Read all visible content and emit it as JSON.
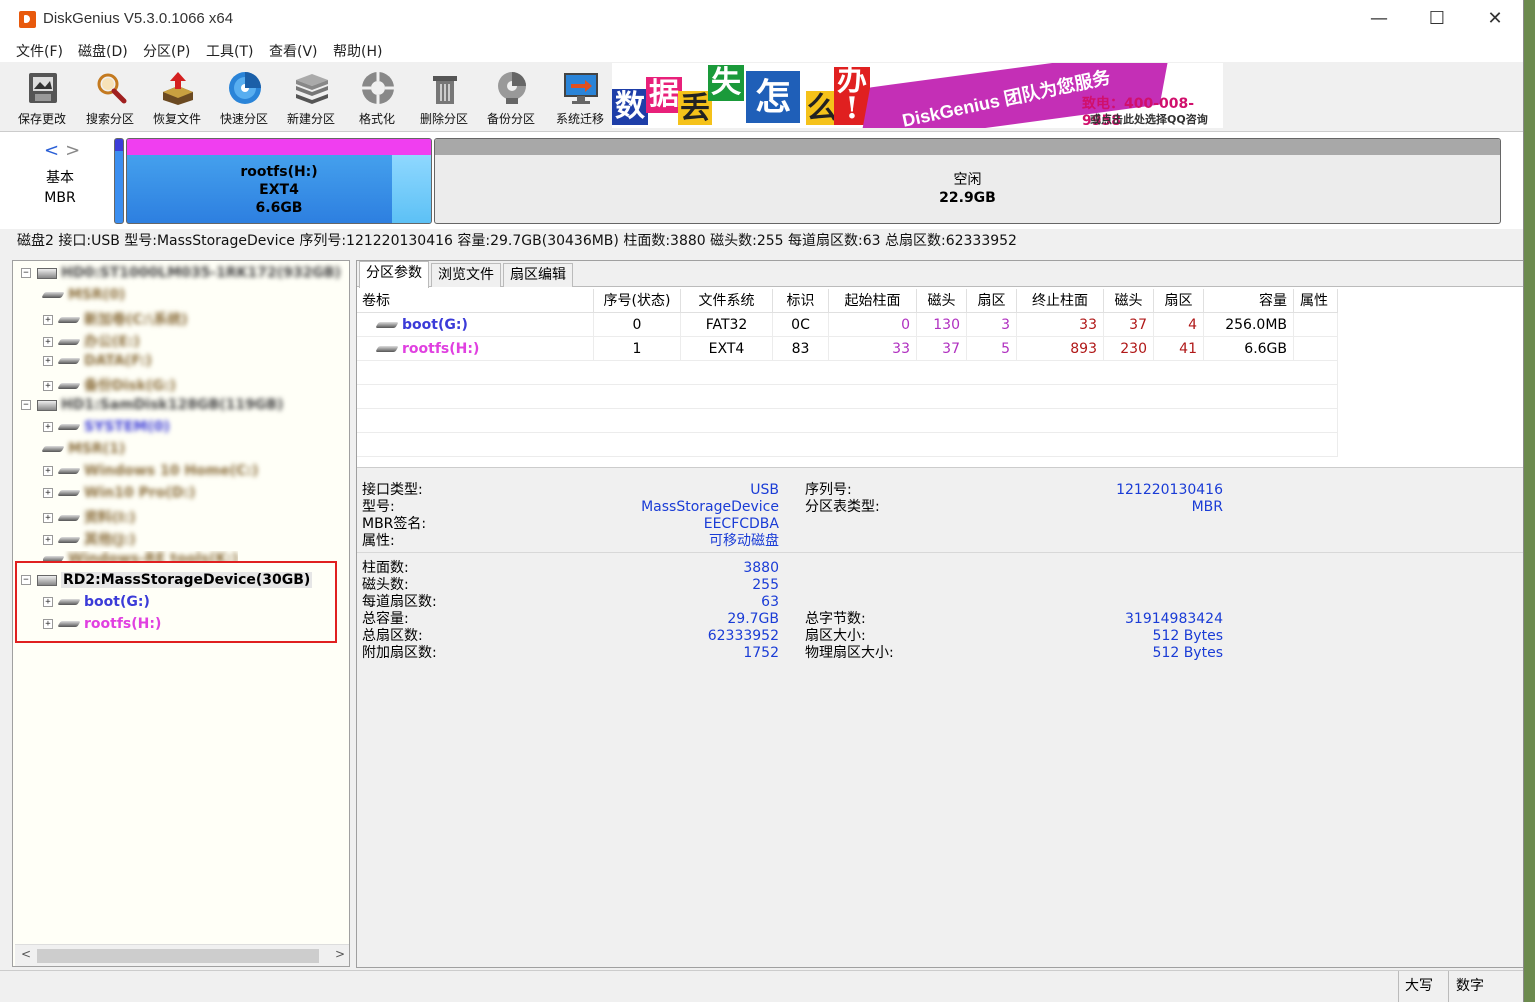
{
  "window": {
    "title": "DiskGenius V5.3.0.1066 x64"
  },
  "controls": {
    "minimize": "—",
    "maximize": "☐",
    "close": "✕"
  },
  "menu": [
    "文件(F)",
    "磁盘(D)",
    "分区(P)",
    "工具(T)",
    "查看(V)",
    "帮助(H)"
  ],
  "toolbar": [
    {
      "label": "保存更改",
      "icon": "save-icon"
    },
    {
      "label": "搜索分区",
      "icon": "search-icon"
    },
    {
      "label": "恢复文件",
      "icon": "recover-icon"
    },
    {
      "label": "快速分区",
      "icon": "quick-partition-icon"
    },
    {
      "label": "新建分区",
      "icon": "new-partition-icon"
    },
    {
      "label": "格式化",
      "icon": "format-icon"
    },
    {
      "label": "删除分区",
      "icon": "delete-icon"
    },
    {
      "label": "备份分区",
      "icon": "backup-icon"
    },
    {
      "label": "系统迁移",
      "icon": "migrate-icon"
    }
  ],
  "banner": {
    "chars": [
      "数",
      "据",
      "丢",
      "失",
      "怎",
      "么",
      "办",
      "!"
    ],
    "slogan": "DiskGenius 团队为您服务",
    "phone": "致电：400-008-9958",
    "qq": "或点击此处选择QQ咨询"
  },
  "diskmap": {
    "type_line1": "基本",
    "type_line2": "MBR",
    "partition1": {
      "name": "rootfs(H:)",
      "fs": "EXT4",
      "size": "6.6GB"
    },
    "free": {
      "name": "空闲",
      "size": "22.9GB"
    }
  },
  "disk_info_line": "磁盘2 接口:USB  型号:MassStorageDevice  序列号:121220130416  容量:29.7GB(30436MB)  柱面数:3880  磁头数:255  每道扇区数:63  总扇区数:62333952",
  "tree": {
    "disk0": "HD0:ST1000LM035-1RK172(932GB)",
    "disk0_parts": [
      "MSR(0)",
      "新加卷(C:\\系统)",
      "办公(E:)",
      "DATA(F:)",
      "备份Disk(G:)"
    ],
    "disk1": "HD1:SamDisk128GB(119GB)",
    "disk1_parts": [
      "SYSTEM(0)",
      "MSR(1)",
      "Windows 10 Home(C:)",
      "Win10 Pro(D:)",
      "资料(I:)",
      "其他(J:)",
      "Windows-RE tools(K:)"
    ],
    "disk2": "RD2:MassStorageDevice(30GB)",
    "disk2_parts": [
      "boot(G:)",
      "rootfs(H:)"
    ]
  },
  "tabs": [
    "分区参数",
    "浏览文件",
    "扇区编辑"
  ],
  "table": {
    "headers": [
      "卷标",
      "序号(状态)",
      "文件系统",
      "标识",
      "起始柱面",
      "磁头",
      "扇区",
      "终止柱面",
      "磁头",
      "扇区",
      "容量",
      "属性"
    ],
    "rows": [
      {
        "label": "boot(G:)",
        "index": "0",
        "fs": "FAT32",
        "id": "0C",
        "start_cyl": "0",
        "start_head": "130",
        "start_sec": "3",
        "end_cyl": "33",
        "end_head": "37",
        "end_sec": "4",
        "size": "256.0MB",
        "attr": ""
      },
      {
        "label": "rootfs(H:)",
        "index": "1",
        "fs": "EXT4",
        "id": "83",
        "start_cyl": "33",
        "start_head": "37",
        "start_sec": "5",
        "end_cyl": "893",
        "end_head": "230",
        "end_sec": "41",
        "size": "6.6GB",
        "attr": ""
      }
    ]
  },
  "details": {
    "interface_label": "接口类型:",
    "interface": "USB",
    "serial_label": "序列号:",
    "serial": "121220130416",
    "model_label": "型号:",
    "model": "MassStorageDevice",
    "pt_label": "分区表类型:",
    "pt": "MBR",
    "mbr_sig_label": "MBR签名:",
    "mbr_sig": "EECFCDBA",
    "attr_label": "属性:",
    "attr": "可移动磁盘",
    "cyl_label": "柱面数:",
    "cyl": "3880",
    "heads_label": "磁头数:",
    "heads": "255",
    "spt_label": "每道扇区数:",
    "spt": "63",
    "cap_label": "总容量:",
    "cap": "29.7GB",
    "bytes_label": "总字节数:",
    "bytes": "31914983424",
    "sectors_label": "总扇区数:",
    "sectors": "62333952",
    "secsize_label": "扇区大小:",
    "secsize": "512 Bytes",
    "extra_label": "附加扇区数:",
    "extra": "1752",
    "physsec_label": "物理扇区大小:",
    "physsec": "512 Bytes"
  },
  "status": {
    "caps": "大写",
    "num": "数字"
  },
  "colors": {
    "boot": "#3b3bd8",
    "rootfs": "#e040e0",
    "value": "#1a3cd6",
    "red_num": "#b01818",
    "purple_num": "#b030c0"
  }
}
